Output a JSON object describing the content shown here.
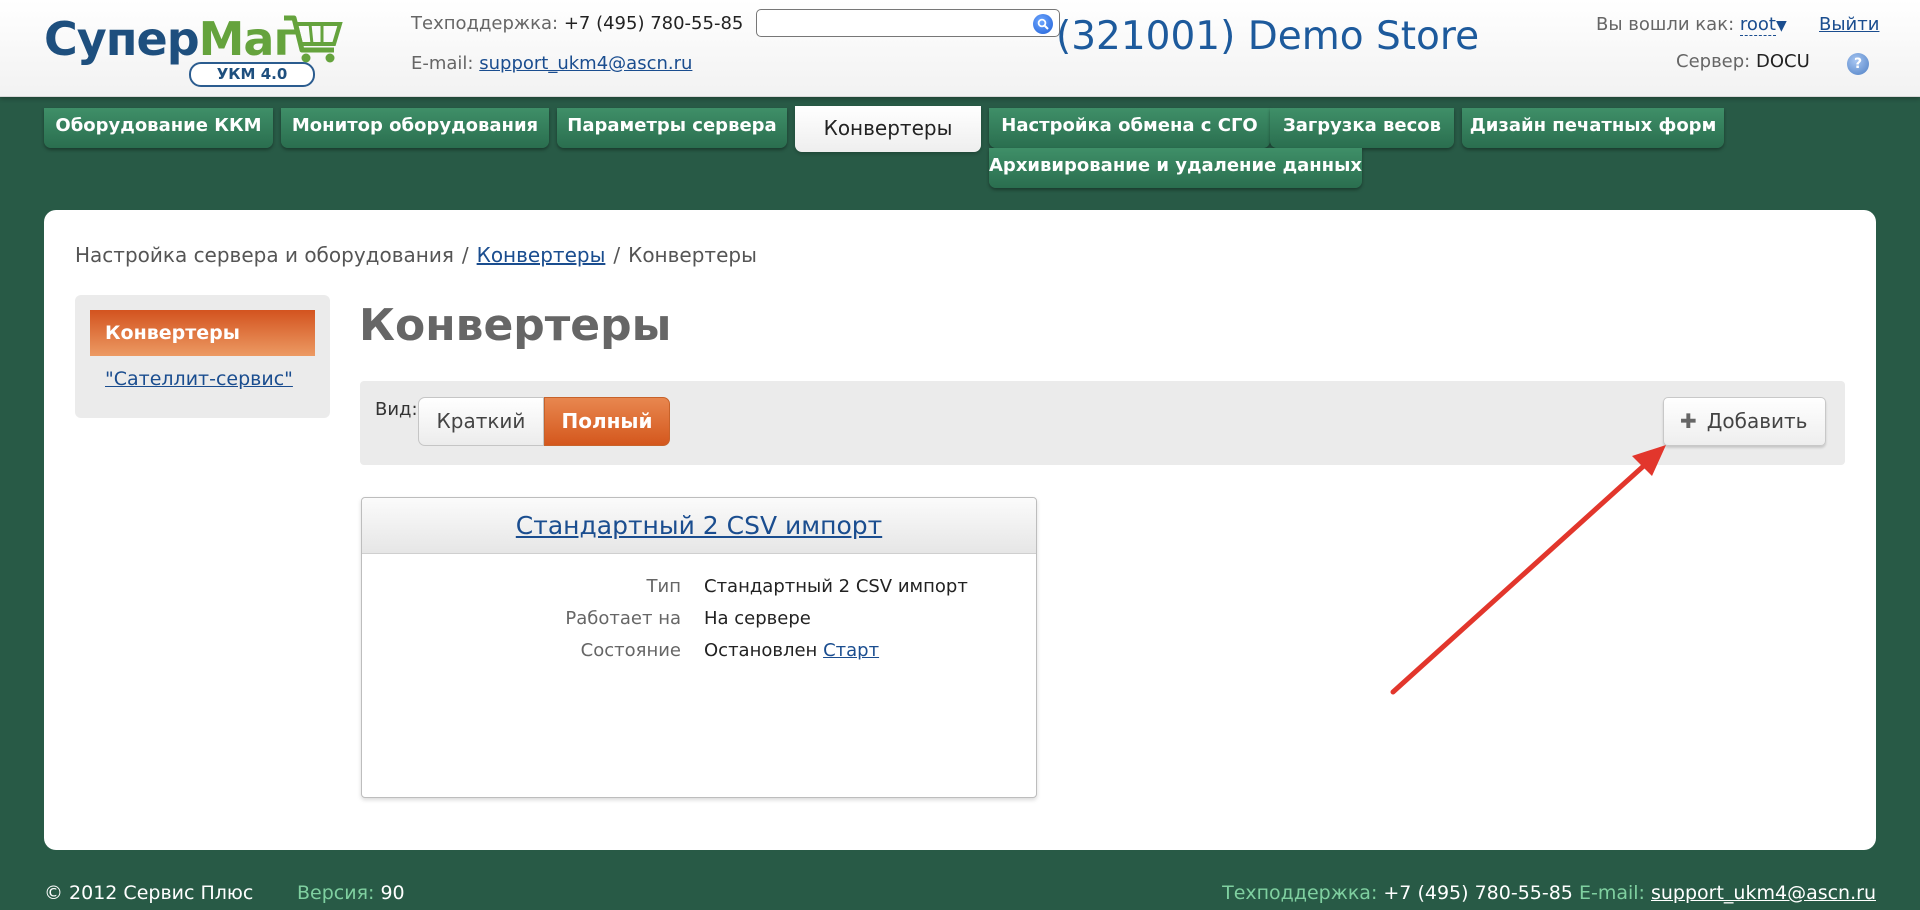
{
  "logo": {
    "part1": "Супер",
    "part2": "Маг",
    "badge": "УКМ 4.0"
  },
  "support": {
    "phone_label": "Техподдержка:",
    "phone": "+7 (495) 780-55-85",
    "email_label": "E-mail:",
    "email": "support_ukm4@ascn.ru"
  },
  "search": {
    "placeholder": "",
    "value": "",
    "icon": "search-icon"
  },
  "store_title": "(321001) Demo Store",
  "user": {
    "label": "Вы вошли как:",
    "name": "root",
    "caret": "▼",
    "logout": "Выйти"
  },
  "server": {
    "label": "Сервер:",
    "name": "DOCU",
    "help": "?"
  },
  "nav": {
    "tabs": [
      {
        "label": "Оборудование ККМ"
      },
      {
        "label": "Монитор оборудования"
      },
      {
        "label": "Параметры сервера"
      },
      {
        "label": "Конвертеры",
        "active": true
      },
      {
        "label": "Настройка обмена с СГО"
      },
      {
        "label": "Загрузка весов"
      },
      {
        "label": "Дизайн печатных форм"
      },
      {
        "label": "Архивирование и удаление данных"
      }
    ]
  },
  "breadcrumb": {
    "root": "Настройка сервера и оборудования",
    "sep": "/",
    "link": "Конвертеры",
    "current": "Конвертеры"
  },
  "sidebar": {
    "active": "Конвертеры",
    "link": "\"Сателлит-сервис\""
  },
  "main": {
    "title": "Конвертеры",
    "view_label": "Вид:",
    "view_brief": "Краткий",
    "view_full": "Полный",
    "add_label": "Добавить"
  },
  "card": {
    "title": "Стандартный 2 CSV импорт",
    "rows": [
      {
        "key": "Тип",
        "value": "Стандартный 2 CSV импорт"
      },
      {
        "key": "Работает на",
        "value": "На сервере"
      },
      {
        "key": "Состояние",
        "value": "Остановлен",
        "action": "Старт"
      }
    ]
  },
  "footer": {
    "copyright": "© 2012 Сервис Плюс",
    "version_label": "Версия:",
    "version": "90",
    "phone_label": "Техподдержка:",
    "phone": "+7 (495) 780-55-85",
    "email_label": "E-mail:",
    "email": "support_ukm4@ascn.ru"
  },
  "colors": {
    "background": "#285a46",
    "tab": "#3a8763",
    "accent_orange": "#d95a22",
    "link": "#1a4d8f",
    "annotation_arrow": "#e2362c"
  }
}
